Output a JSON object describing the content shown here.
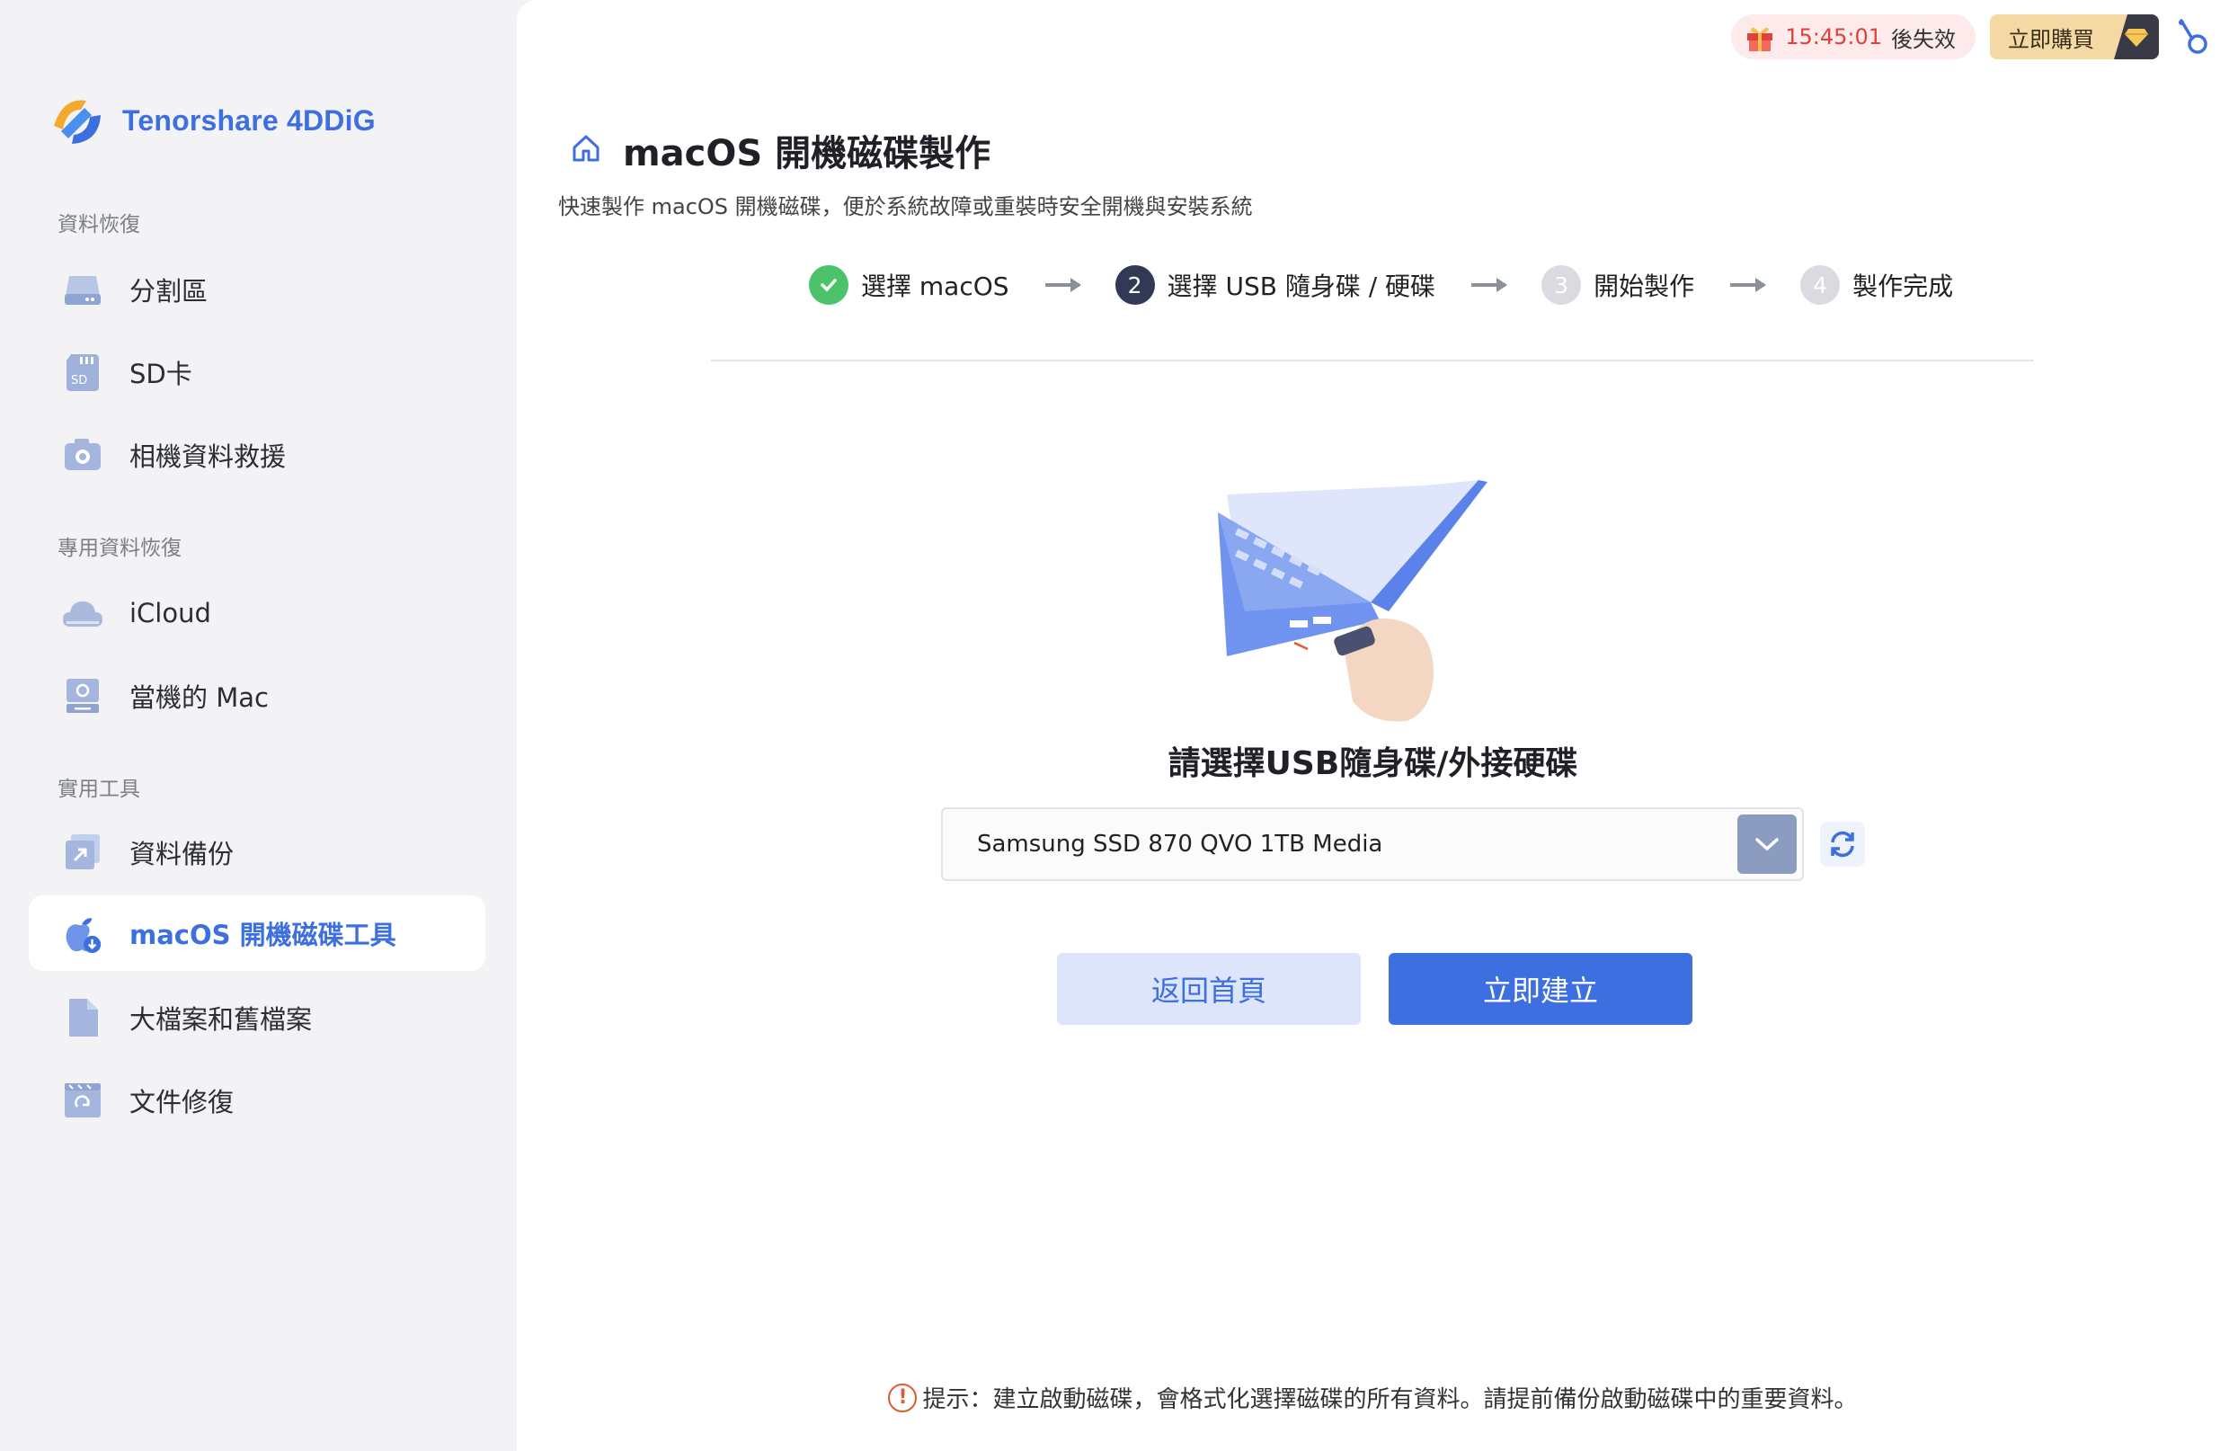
{
  "app": {
    "brand": "Tenorshare 4DDiG"
  },
  "sidebar": {
    "sections": [
      {
        "title": "資料恢復"
      },
      {
        "title": "專用資料恢復"
      },
      {
        "title": "實用工具"
      }
    ],
    "items": [
      {
        "label": "分割區",
        "icon": "drive-icon"
      },
      {
        "label": "SD卡",
        "icon": "sd-card-icon"
      },
      {
        "label": "相機資料救援",
        "icon": "camera-icon"
      },
      {
        "label": "iCloud",
        "icon": "cloud-icon"
      },
      {
        "label": "當機的 Mac",
        "icon": "crashed-mac-icon"
      },
      {
        "label": "資料備份",
        "icon": "backup-icon"
      },
      {
        "label": "macOS 開機磁碟工具",
        "icon": "macos-boot-icon",
        "active": true
      },
      {
        "label": "大檔案和舊檔案",
        "icon": "file-icon"
      },
      {
        "label": "文件修復",
        "icon": "document-repair-icon"
      }
    ]
  },
  "topbar": {
    "timer": "15:45:01",
    "timer_suffix": "後失效",
    "buy_label": "立即購買"
  },
  "page": {
    "title": "macOS 開機磁碟製作",
    "subtitle": "快速製作 macOS 開機磁碟，便於系統故障或重裝時安全開機與安裝系統"
  },
  "steps": [
    {
      "number": "",
      "label": "選擇 macOS",
      "state": "done"
    },
    {
      "number": "2",
      "label": "選擇 USB 隨身碟 / 硬碟",
      "state": "current"
    },
    {
      "number": "3",
      "label": "開始製作",
      "state": "todo"
    },
    {
      "number": "4",
      "label": "製作完成",
      "state": "todo"
    }
  ],
  "prompt": "請選擇USB隨身碟/外接硬碟",
  "select": {
    "value": "Samsung SSD 870 QVO 1TB Media"
  },
  "buttons": {
    "back": "返回首頁",
    "create": "立即建立"
  },
  "tip": "提示：建立啟動磁碟，會格式化選擇磁碟的所有資料。請提前備份啟動磁碟中的重要資料。",
  "colors": {
    "accent": "#3d6fe0",
    "done": "#4cc26b",
    "warning": "#e05a32"
  }
}
